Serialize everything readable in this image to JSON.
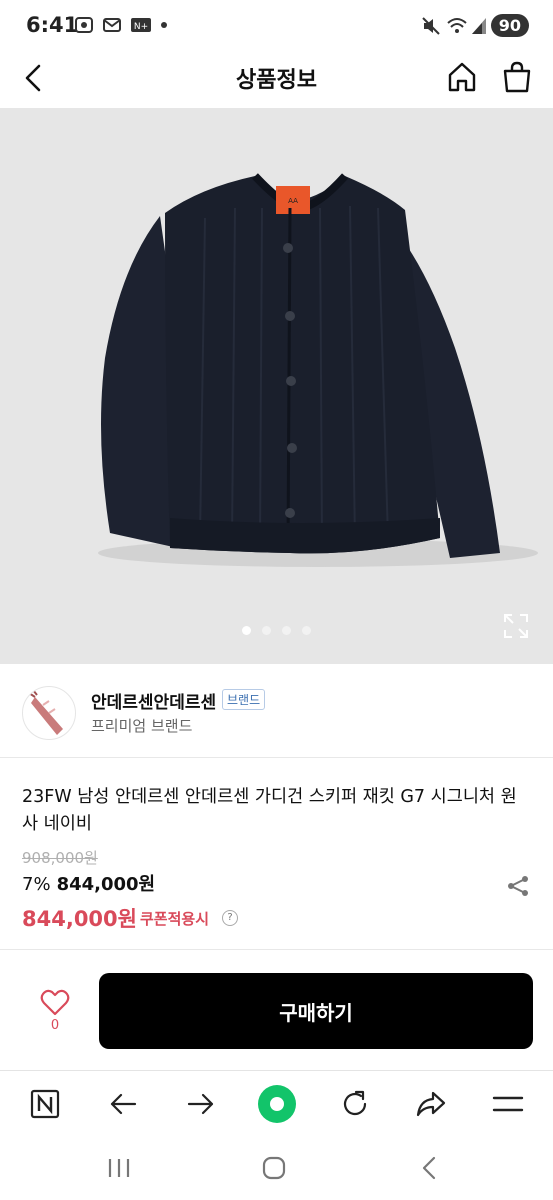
{
  "status_bar": {
    "time": "6:41",
    "battery": "90",
    "icons": [
      "screenshot-icon",
      "mail-icon",
      "n-plus-icon",
      "dot-icon",
      "mute-icon",
      "wifi-icon",
      "signal-icon"
    ]
  },
  "top_bar": {
    "title": "상품정보",
    "icons": [
      "back-arrow-icon",
      "home-icon",
      "shopping-bag-icon"
    ]
  },
  "gallery": {
    "image_count": 4,
    "active_index": 0,
    "icons": [
      "expand-icon"
    ]
  },
  "brand": {
    "name": "안데르센안데르센",
    "badge": "브랜드",
    "subtitle": "프리미엄 브랜드"
  },
  "product": {
    "title": "23FW 남성 안데르센 안데르센 가디건 스키퍼 재킷 G7 시그니처 원사 네이비",
    "original_price": "908,000원",
    "discount_percent": "7%",
    "price": "844,000원",
    "coupon_price": "844,000원",
    "coupon_label": "쿠폰적용시",
    "help": "?",
    "icons": [
      "share-icon"
    ]
  },
  "buy_bar": {
    "like_count": "0",
    "buy_label": "구매하기"
  },
  "browser_bar": {
    "icons": [
      "naver-n-icon",
      "back-icon",
      "forward-icon",
      "green-dot-icon",
      "refresh-icon",
      "share-arrow-icon",
      "menu-icon"
    ]
  },
  "system_nav": {
    "icons": [
      "recents-icon",
      "home-circle-icon",
      "back-chevron-icon"
    ]
  },
  "colors": {
    "accent": "#d94a5a",
    "green": "#12c46a",
    "button": "#000000"
  }
}
